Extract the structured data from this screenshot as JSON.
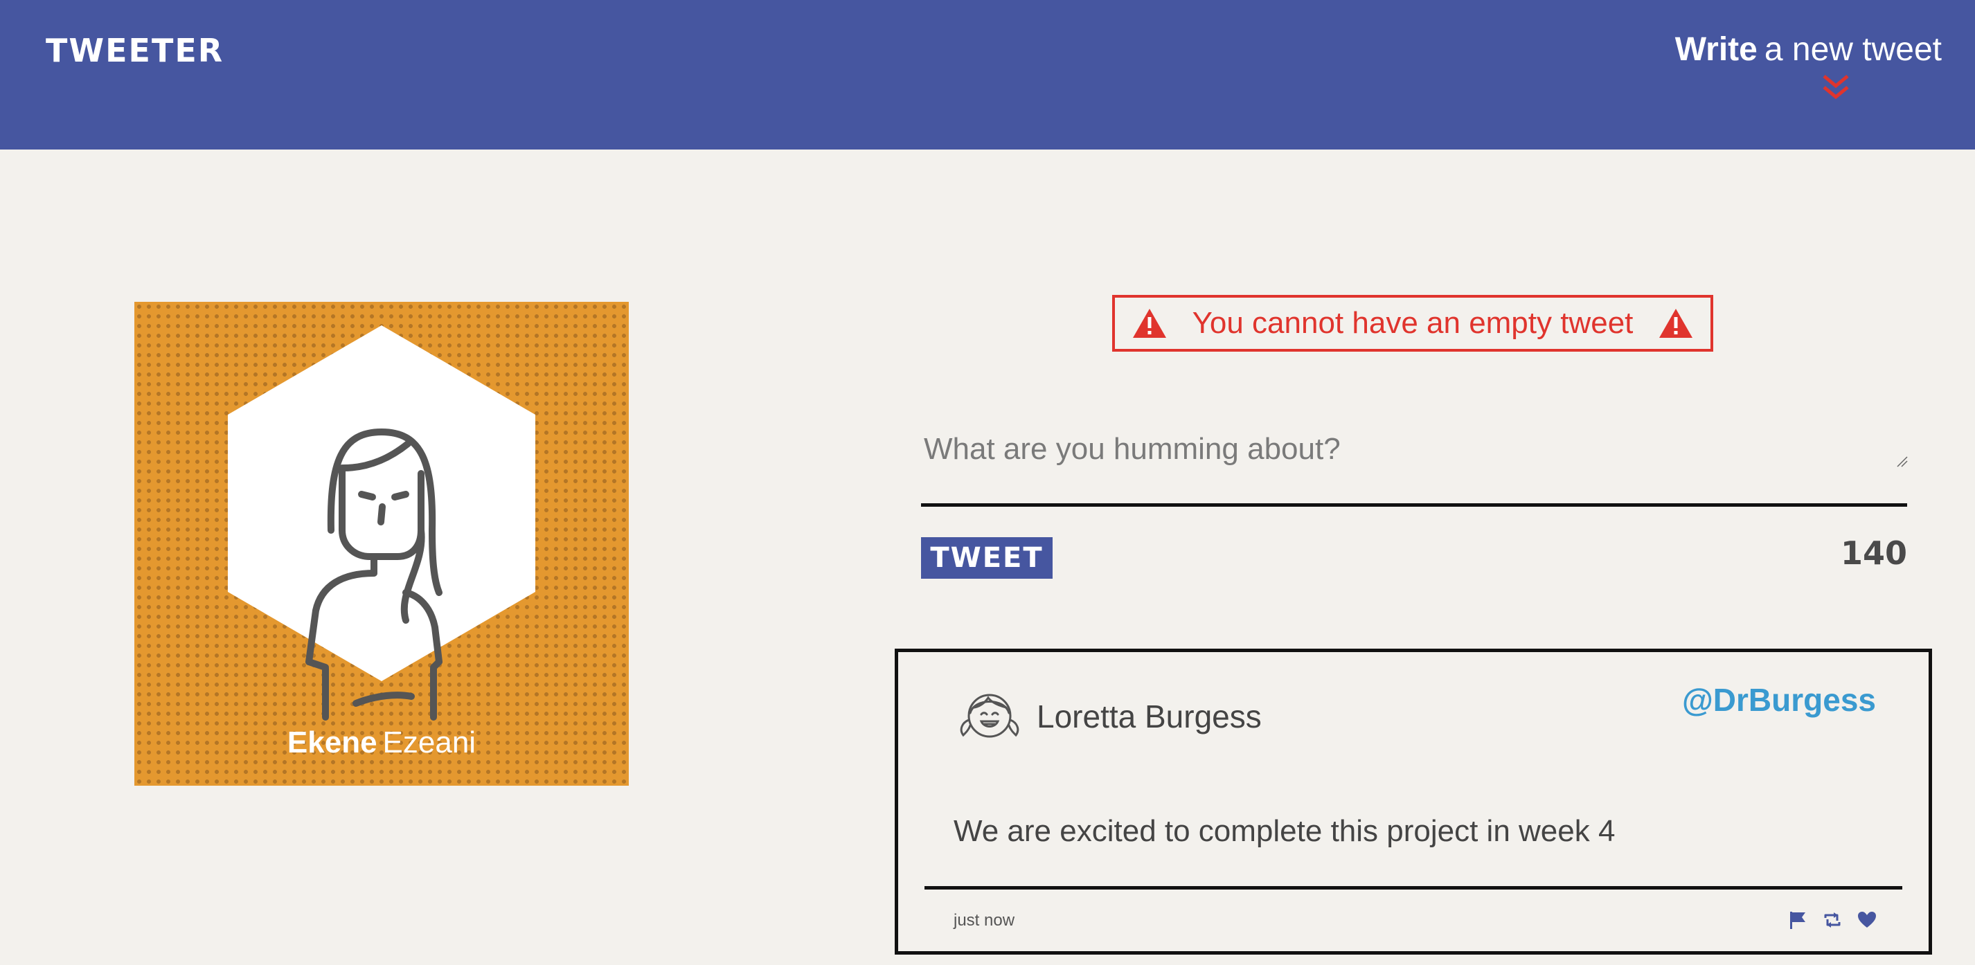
{
  "nav": {
    "brand": "TWEETER",
    "compose_strong": "Write",
    "compose_light": "a new tweet",
    "compose_icon": "double-chevron-down-icon"
  },
  "profile": {
    "first_name": "Ekene",
    "last_name": "Ezeani",
    "avatar_icon": "woman-avatar-icon"
  },
  "composer": {
    "error_text": "You cannot have an empty tweet",
    "error_icon": "warning-triangle-icon",
    "placeholder": "What are you humming about?",
    "value": "",
    "submit_label": "TWEET",
    "char_count": "140"
  },
  "tweets": [
    {
      "name": "Loretta Burgess",
      "handle": "@DrBurgess",
      "text": "We are excited to complete this project in week 4",
      "time": "just now",
      "actions": [
        "flag-icon",
        "retweet-icon",
        "heart-icon"
      ]
    }
  ],
  "colors": {
    "nav": "#4656a0",
    "background": "#f3f1ed",
    "error": "#e0342d",
    "profile_bg": "#e4982f",
    "handle": "#3a9ad0"
  }
}
